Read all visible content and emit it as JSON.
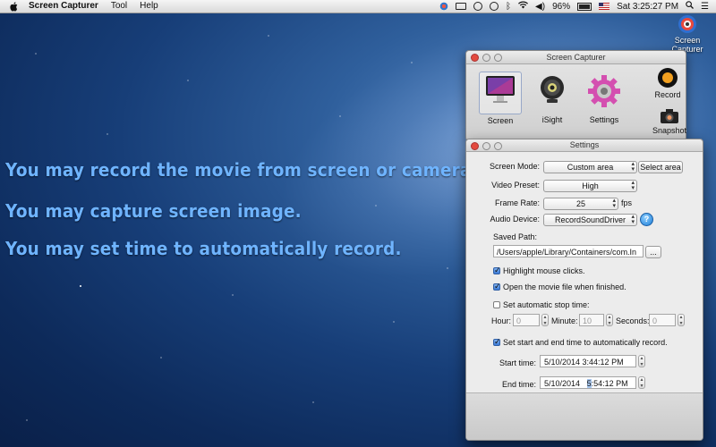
{
  "menubar": {
    "app_name": "Screen Capturer",
    "menus": [
      "Tool",
      "Help"
    ],
    "battery_percent": "96%",
    "clock": "Sat 3:25:27 PM",
    "battery_level": 0.96
  },
  "desktop_icon": {
    "label_line1": "Screen",
    "label_line2": "Capturer"
  },
  "promo": [
    "You may record the movie from screen or camera.",
    "You may capture screen image.",
    "You may set time to automatically record."
  ],
  "main_window": {
    "title": "Screen Capturer",
    "tools": {
      "screen": "Screen",
      "isight": "iSight",
      "settings": "Settings",
      "record": "Record",
      "snapshot": "Snapshot"
    },
    "selected_tool": "Screen"
  },
  "settings": {
    "title": "Settings",
    "screen_mode_label": "Screen Mode:",
    "screen_mode_value": "Custom area",
    "select_area_button": "Select area",
    "video_preset_label": "Video Preset:",
    "video_preset_value": "High",
    "frame_rate_label": "Frame Rate:",
    "frame_rate_value": "25",
    "frame_rate_unit": "fps",
    "audio_device_label": "Audio Device:",
    "audio_device_value": "RecordSoundDriver",
    "saved_path_label": "Saved Path:",
    "saved_path_value": "/Users/apple/Library/Containers/com.In",
    "browse_button": "...",
    "highlight_clicks": {
      "label": "Highlight mouse clicks.",
      "checked": true
    },
    "open_movie": {
      "label": "Open the movie file when finished.",
      "checked": true
    },
    "auto_stop": {
      "label": "Set automatic stop time:",
      "checked": false
    },
    "hour_label": "Hour:",
    "hour_value": "0",
    "minute_label": "Minute:",
    "minute_value": "10",
    "seconds_label": "Seconds:",
    "seconds_value": "0",
    "schedule": {
      "label": "Set start and end time to automatically record.",
      "checked": true
    },
    "start_time_label": "Start time:",
    "start_time_value": "5/10/2014   3:44:12 PM",
    "end_time_label": "End time:",
    "end_date_value": "5/10/2014",
    "end_hour_value": "5",
    "end_rest_value": ":54:12 PM"
  },
  "colors": {
    "promo_text": "#6fb4ff",
    "selection": "#a9c8f0",
    "close_button": "#e34a3e"
  }
}
